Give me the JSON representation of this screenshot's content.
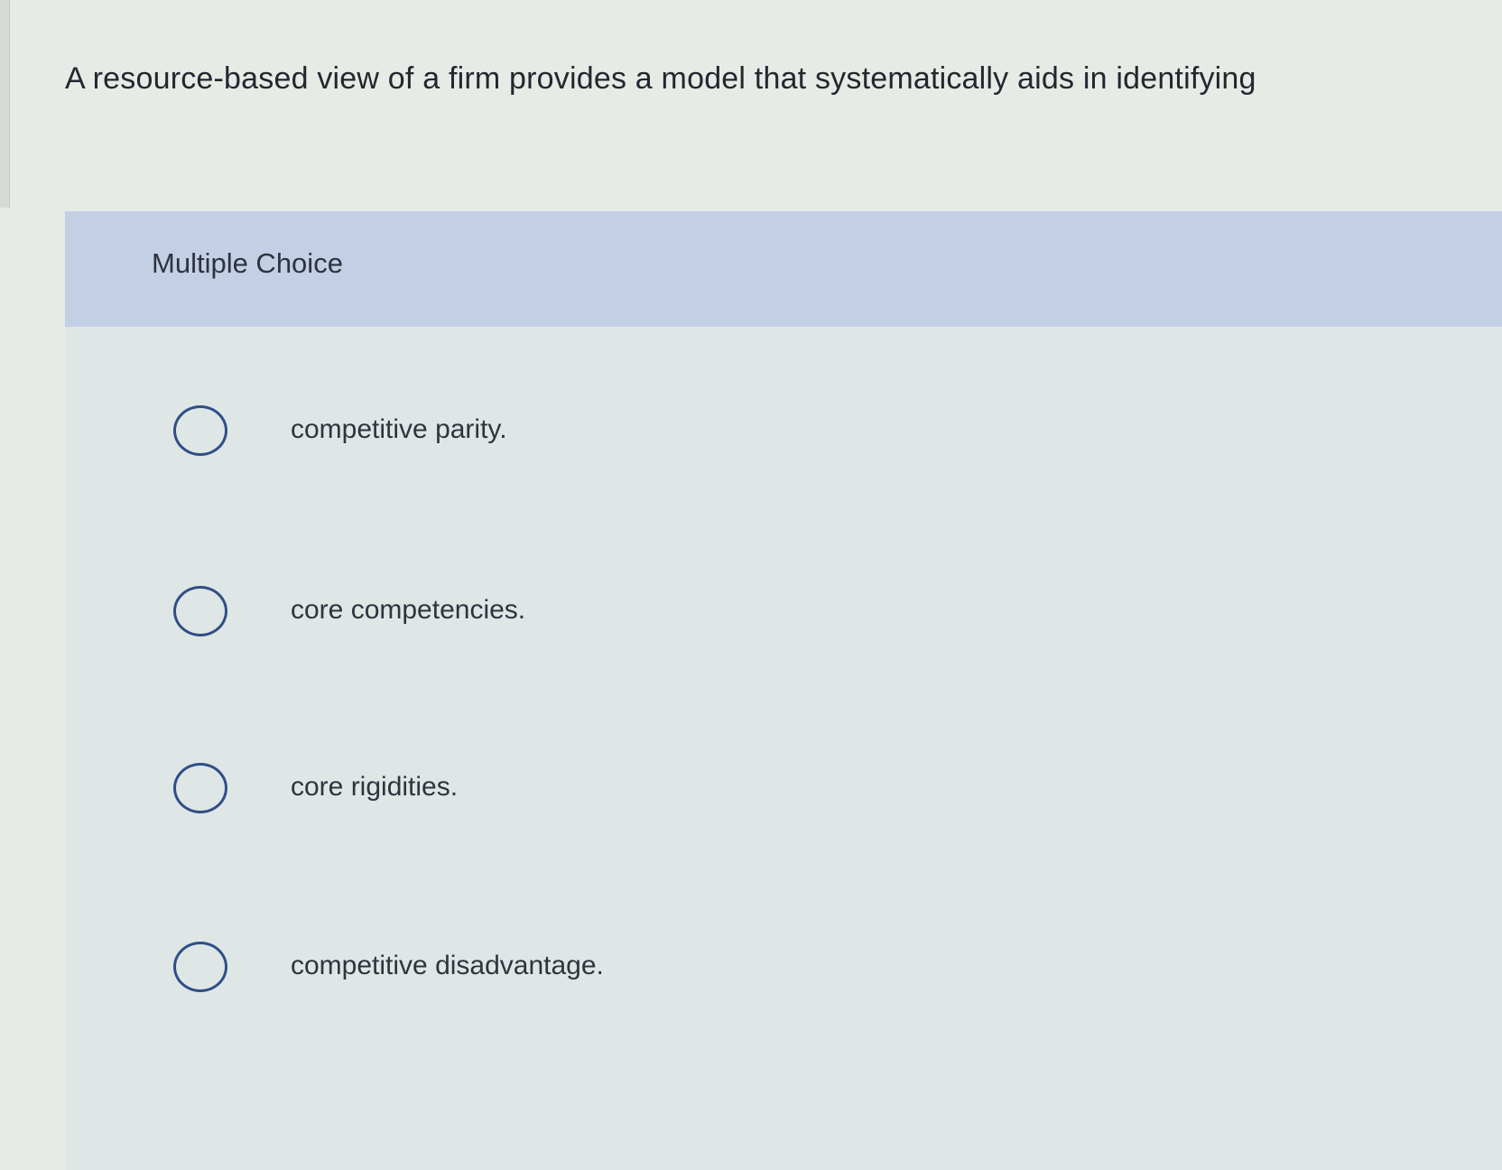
{
  "question": {
    "text": "A resource-based view of a firm provides a model that systematically aids in identifying"
  },
  "panel": {
    "title": "Multiple Choice",
    "options": [
      {
        "label": "competitive parity.",
        "selected": false
      },
      {
        "label": "core competencies.",
        "selected": false
      },
      {
        "label": "core rigidities.",
        "selected": false
      },
      {
        "label": "competitive disadvantage.",
        "selected": false
      }
    ]
  },
  "colors": {
    "header_band": "#c3cfe4",
    "radio_border": "#2f4f86",
    "panel_bg": "#dfe6e6"
  }
}
